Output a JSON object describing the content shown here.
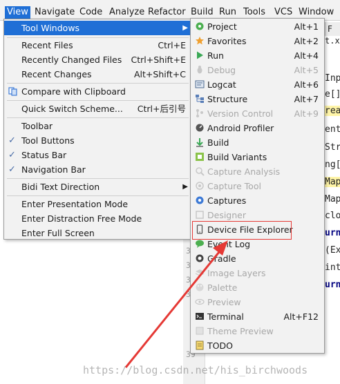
{
  "menubar": {
    "items": [
      "View",
      "Navigate",
      "Code",
      "Analyze",
      "Refactor",
      "Build",
      "Run",
      "Tools",
      "VCS",
      "Window"
    ]
  },
  "view_menu": {
    "items": [
      {
        "label": "Tool Windows",
        "shortcut": "",
        "submenu": true,
        "selected": true
      },
      {
        "label": "Recent Files",
        "shortcut": "Ctrl+E"
      },
      {
        "label": "Recently Changed Files",
        "shortcut": "Ctrl+Shift+E"
      },
      {
        "label": "Recent Changes",
        "shortcut": "Alt+Shift+C"
      },
      {
        "label": "Compare with Clipboard",
        "shortcut": ""
      },
      {
        "label": "Quick Switch Scheme...",
        "shortcut": "Ctrl+后引号"
      },
      {
        "label": "Toolbar",
        "shortcut": "",
        "checked": false
      },
      {
        "label": "Tool Buttons",
        "shortcut": "",
        "checked": true
      },
      {
        "label": "Status Bar",
        "shortcut": "",
        "checked": true
      },
      {
        "label": "Navigation Bar",
        "shortcut": "",
        "checked": true
      },
      {
        "label": "Bidi Text Direction",
        "shortcut": "",
        "submenu": true
      },
      {
        "label": "Enter Presentation Mode",
        "shortcut": ""
      },
      {
        "label": "Enter Distraction Free Mode",
        "shortcut": ""
      },
      {
        "label": "Enter Full Screen",
        "shortcut": ""
      }
    ]
  },
  "tool_windows_menu": {
    "items": [
      {
        "label": "Project",
        "shortcut": "Alt+1",
        "enabled": true,
        "icon": "project-icon"
      },
      {
        "label": "Favorites",
        "shortcut": "Alt+2",
        "enabled": true,
        "icon": "star-icon"
      },
      {
        "label": "Run",
        "shortcut": "Alt+4",
        "enabled": true,
        "icon": "run-icon"
      },
      {
        "label": "Debug",
        "shortcut": "Alt+5",
        "enabled": false,
        "icon": "debug-icon"
      },
      {
        "label": "Logcat",
        "shortcut": "Alt+6",
        "enabled": true,
        "icon": "logcat-icon"
      },
      {
        "label": "Structure",
        "shortcut": "Alt+7",
        "enabled": true,
        "icon": "structure-icon"
      },
      {
        "label": "Version Control",
        "shortcut": "Alt+9",
        "enabled": false,
        "icon": "vcs-icon"
      },
      {
        "label": "Android Profiler",
        "shortcut": "",
        "enabled": true,
        "icon": "profiler-icon"
      },
      {
        "label": "Build",
        "shortcut": "",
        "enabled": true,
        "icon": "build-icon"
      },
      {
        "label": "Build Variants",
        "shortcut": "",
        "enabled": true,
        "icon": "build-variants-icon"
      },
      {
        "label": "Capture Analysis",
        "shortcut": "",
        "enabled": false,
        "icon": "capture-analysis-icon"
      },
      {
        "label": "Capture Tool",
        "shortcut": "",
        "enabled": false,
        "icon": "capture-tool-icon"
      },
      {
        "label": "Captures",
        "shortcut": "",
        "enabled": true,
        "icon": "captures-icon"
      },
      {
        "label": "Designer",
        "shortcut": "",
        "enabled": false,
        "icon": "designer-icon"
      },
      {
        "label": "Device File Explorer",
        "shortcut": "",
        "enabled": true,
        "icon": "device-icon"
      },
      {
        "label": "Event Log",
        "shortcut": "",
        "enabled": true,
        "icon": "event-log-icon"
      },
      {
        "label": "Gradle",
        "shortcut": "",
        "enabled": true,
        "icon": "gradle-icon"
      },
      {
        "label": "Image Layers",
        "shortcut": "",
        "enabled": false,
        "icon": "image-layers-icon"
      },
      {
        "label": "Palette",
        "shortcut": "",
        "enabled": false,
        "icon": "palette-icon"
      },
      {
        "label": "Preview",
        "shortcut": "",
        "enabled": false,
        "icon": "preview-icon"
      },
      {
        "label": "Terminal",
        "shortcut": "Alt+F12",
        "enabled": true,
        "icon": "terminal-icon"
      },
      {
        "label": "Theme Preview",
        "shortcut": "",
        "enabled": false,
        "icon": "theme-preview-icon"
      },
      {
        "label": "TODO",
        "shortcut": "",
        "enabled": true,
        "icon": "todo-icon"
      }
    ]
  },
  "editor": {
    "tab_fragment": "F",
    "tab_suffix": "t.xm",
    "line_numbers": [
      "3",
      "3",
      "3",
      "3",
      "39"
    ],
    "code_fragments": [
      "Inp",
      "e[]",
      "rea",
      "ent",
      "Str",
      "ng[",
      "Map",
      "Map",
      "clo",
      "urn",
      "(Exc",
      "int",
      "urn"
    ]
  },
  "watermark": "https://blog.csdn.net/his_birchwoods",
  "colors": {
    "selection": "#1f6fd6",
    "highlight_box": "#e53935",
    "arrow": "#e53935"
  }
}
